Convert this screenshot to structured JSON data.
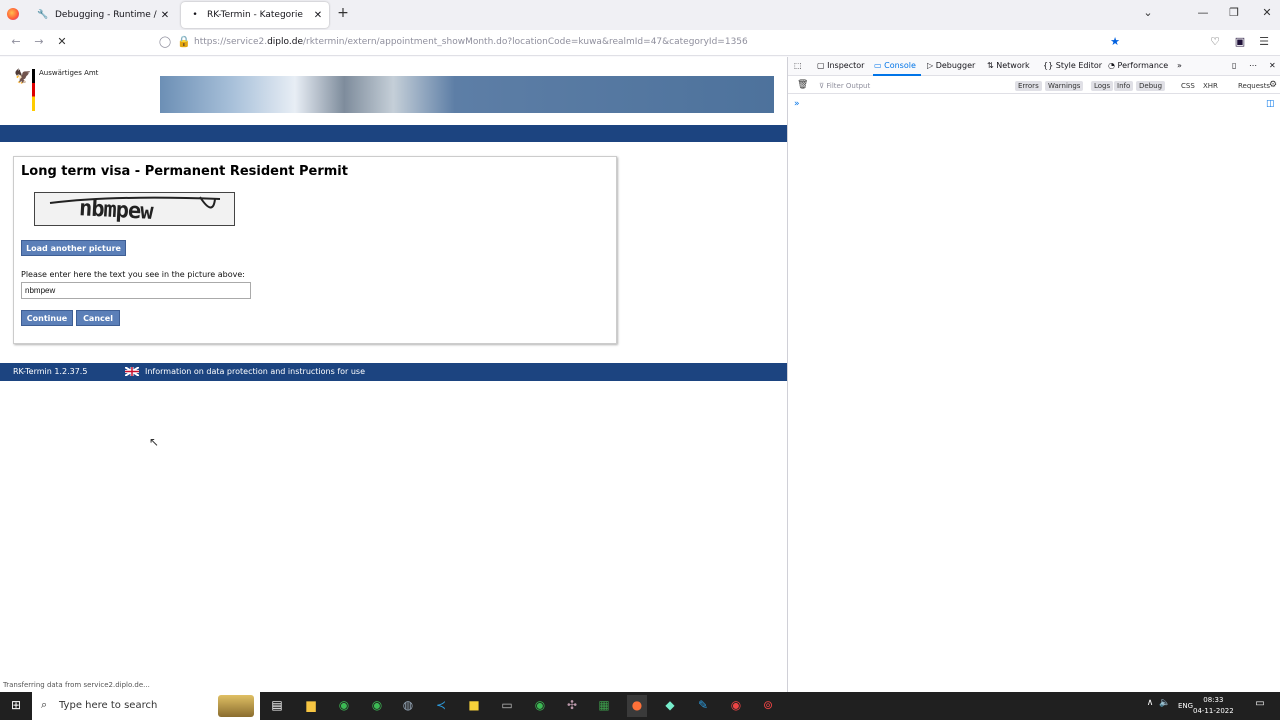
{
  "browser": {
    "tabs": [
      {
        "title": "Debugging - Runtime / this-fire",
        "icon": "wrench-icon"
      },
      {
        "title": "RK-Termin - Kategorie",
        "icon": "loading-dot-icon"
      }
    ],
    "url_prefix": "https://service2.",
    "url_domain": "diplo.de",
    "url_rest": "/rktermin/extern/appointment_showMonth.do?locationCode=kuwa&realmId=47&categoryId=1356",
    "status_text": "Transferring data from service2.diplo.de..."
  },
  "page": {
    "logo_text": "Auswärtiges Amt",
    "heading": "Long term visa - Permanent Resident Permit",
    "captcha_text": "nbmpew",
    "load_another_label": "Load another picture",
    "instruction": "Please enter here the text you see in the picture above:",
    "input_value": "nbmpew",
    "continue_label": "Continue",
    "cancel_label": "Cancel",
    "footer_version": "RK-Termin 1.2.37.5",
    "footer_info": "Information on data protection and instructions for use"
  },
  "devtools": {
    "tabs": [
      "Inspector",
      "Console",
      "Debugger",
      "Network",
      "Style Editor",
      "Performance"
    ],
    "active_tab": "Console",
    "filter_placeholder": "Filter Output",
    "levels": [
      "Errors",
      "Warnings",
      "Logs",
      "Info",
      "Debug"
    ],
    "types": [
      "CSS",
      "XHR",
      "Requests"
    ]
  },
  "taskbar": {
    "search_placeholder": "Type here to search",
    "lang": "ENG",
    "time": "08:33",
    "date": "04-11-2022"
  }
}
